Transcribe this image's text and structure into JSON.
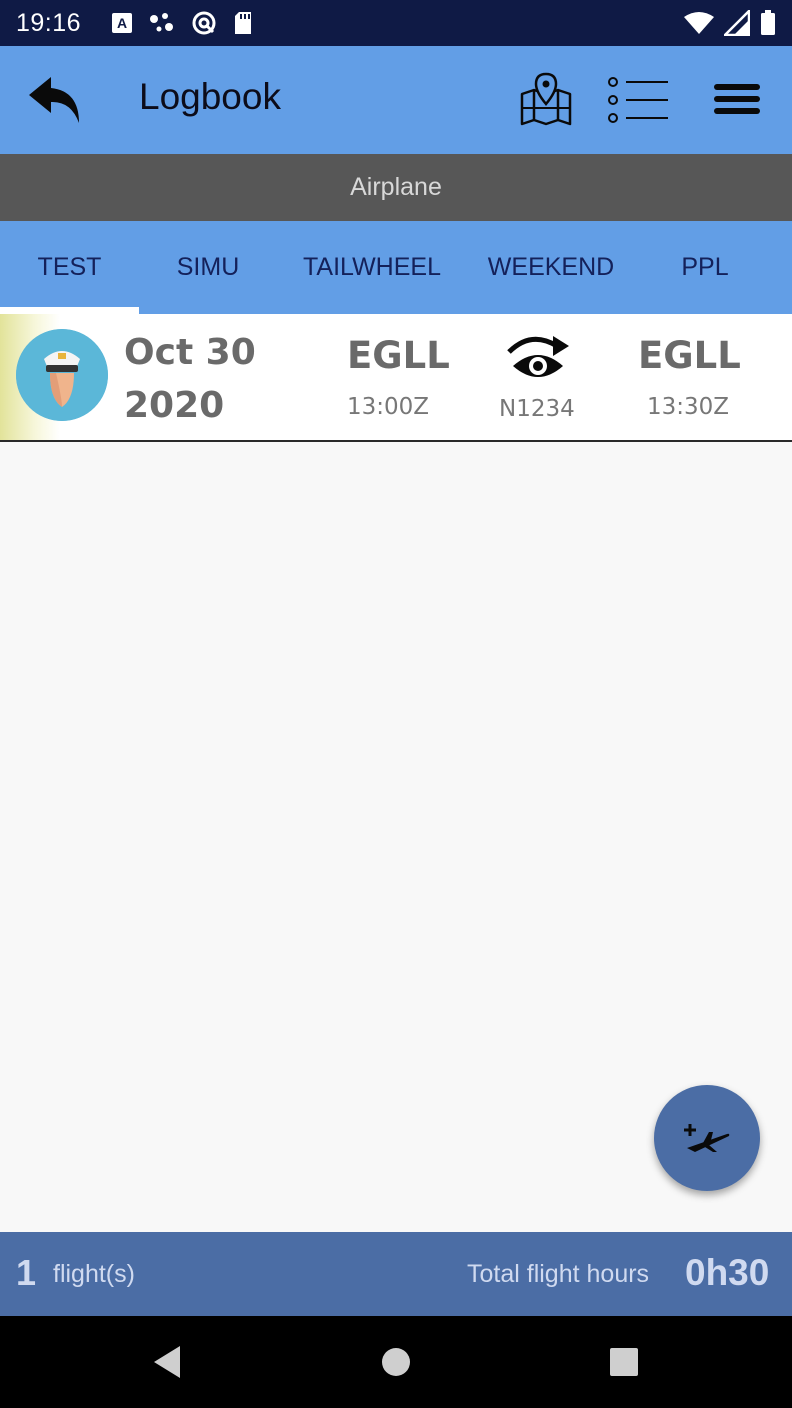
{
  "status_bar": {
    "time": "19:16",
    "icons": [
      "a-notification-icon",
      "dots-icon",
      "sync-icon",
      "sdcard-icon",
      "wifi-icon",
      "signal-icon",
      "battery-icon"
    ]
  },
  "app_bar": {
    "title": "Logbook",
    "icons": [
      "back-icon",
      "map-icon",
      "list-icon",
      "menu-icon"
    ]
  },
  "sub_header": {
    "title": "Airplane"
  },
  "tabs": [
    {
      "label": "TEST",
      "selected": true
    },
    {
      "label": "SIMU",
      "selected": false
    },
    {
      "label": "TAILWHEEL",
      "selected": false
    },
    {
      "label": "WEEKEND",
      "selected": false
    },
    {
      "label": "PPL",
      "selected": false
    }
  ],
  "flights": [
    {
      "date_line1": "Oct 30",
      "date_line2": "2020",
      "departure": "EGLL",
      "departure_time": "13:00Z",
      "arrival": "EGLL",
      "arrival_time": "13:30Z",
      "aircraft": "N1234",
      "icon": "eye-redo-icon"
    }
  ],
  "footer": {
    "flight_count": "1",
    "flight_count_label": "flight(s)",
    "total_label": "Total flight hours",
    "total_value": "0h30"
  },
  "colors": {
    "primary": "#629ee6",
    "status_bar": "#0f1a45",
    "sub_header": "#575757",
    "footer": "#4b6da5",
    "tab_text": "#14215a"
  }
}
